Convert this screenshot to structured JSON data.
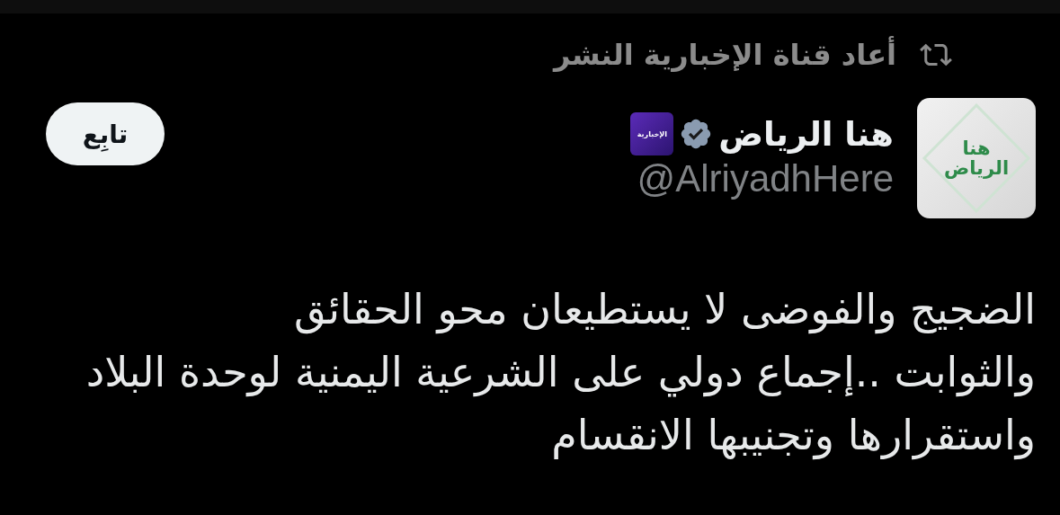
{
  "repost": {
    "text": "أعاد قناة الإخبارية النشر"
  },
  "author": {
    "avatar_text": "هنا\nالرياض",
    "name": "هنا الرياض",
    "verified": true,
    "affiliate_badge": "الإخبارية",
    "handle": "@AlriyadhHere"
  },
  "follow_button": {
    "label": "تابِع"
  },
  "tweet": {
    "text": "الضجيج والفوضى لا يستطيعان محو الحقائق\nوالثوابت ..إجماع دولي على الشرعية اليمنية لوحدة البلاد\nواستقرارها وتجنيبها الانقسام"
  }
}
